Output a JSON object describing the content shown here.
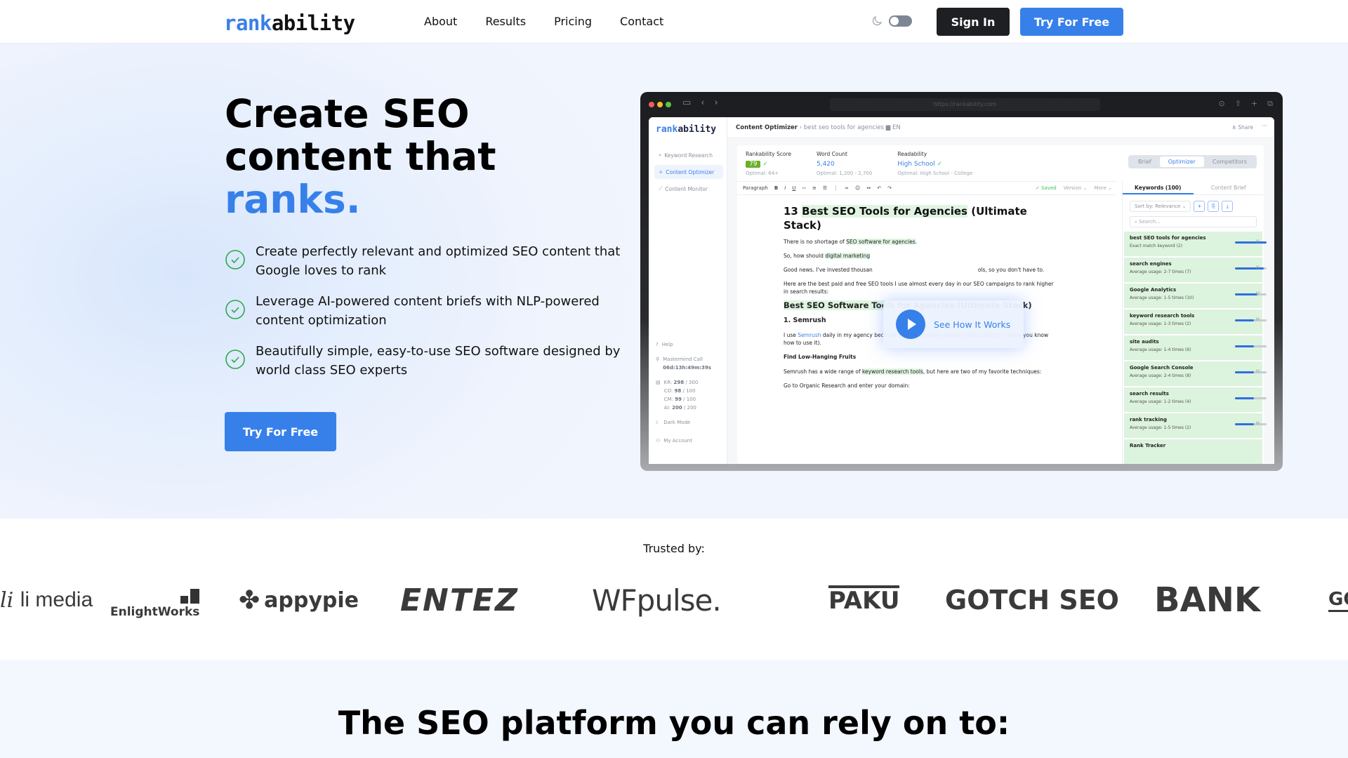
{
  "nav": {
    "logo_part1": "rank",
    "logo_part2": "ability",
    "links": [
      "About",
      "Results",
      "Pricing",
      "Contact"
    ],
    "theme_icon": "moon-icon",
    "sign_in": "Sign In",
    "try_free": "Try For Free"
  },
  "hero": {
    "title_line1": "Create SEO",
    "title_line2": "content that",
    "title_accent": "ranks.",
    "features": [
      {
        "icon": "check-circle-icon",
        "text": "Create perfectly relevant and optimized SEO content that Google loves to rank"
      },
      {
        "icon": "check-circle-icon",
        "text": "Leverage AI-powered content briefs with NLP-powered content optimization"
      },
      {
        "icon": "check-circle-icon",
        "text": "Beautifully simple, easy-to-use SEO software designed by world class SEO experts"
      }
    ],
    "cta": "Try For Free",
    "accent_color": "#3780ea"
  },
  "mockup": {
    "url": "https://rankability.com",
    "app_logo_part1": "rank",
    "app_logo_part2": "ability",
    "sidebar": [
      "Keyword Research",
      "Content Optimizer",
      "Content Monitor"
    ],
    "sidebar_active": "Content Optimizer",
    "sidebar_bottom": {
      "help": "Help",
      "mastermind": "Mastermind Call",
      "countdown": "06d:13h:49m:39s",
      "credits": [
        {
          "label": "KR:",
          "used": "298",
          "total": "/ 300"
        },
        {
          "label": "CO:",
          "used": "98",
          "total": "/ 100"
        },
        {
          "label": "CM:",
          "used": "99",
          "total": "/ 100"
        },
        {
          "label": "AI:",
          "used": "200",
          "total": "/ 200"
        }
      ],
      "dark_mode": "Dark Mode",
      "account": "My Account"
    },
    "header": {
      "title": "Content Optimizer",
      "crumb": "best seo tools for agencies",
      "lang": "EN",
      "share": "Share"
    },
    "metrics": [
      {
        "label": "Rankability Score",
        "value": "79",
        "optimal": "Optimal: 64+"
      },
      {
        "label": "Word Count",
        "value": "5,420",
        "optimal": "Optimal: 1,200 - 2,700"
      },
      {
        "label": "Readability",
        "value": "High School",
        "optimal": "Optimal: High School - College"
      }
    ],
    "segments": [
      "Brief",
      "Optimizer",
      "Competitors"
    ],
    "segment_active": "Optimizer",
    "toolbar": {
      "format": "Paragraph",
      "saved": "✓ Saved",
      "version": "Version ⌄",
      "more": "More ⌄"
    },
    "doc": {
      "h1_pre": "13 ",
      "h1_hl": "Best SEO Tools for Agencies",
      "h1_post": " (Ultimate Stack)",
      "p1_pre": "There is no shortage of ",
      "p1_hl": "SEO software for agencies",
      "p1_post": ".",
      "p2_pre": "So, how should ",
      "p2_hl": "digital marketing",
      "p3": "Good news. I've invested thousan",
      "p3_tail": "ols, so you don't have to.",
      "p4": "Here are the best paid and free SEO tools I use almost every day in our SEO campaigns to rank higher in search results:",
      "h2_hl": "Best SEO Software Tools",
      "h2_post": " for Agencies (Ultimate Stack)",
      "h3": "1. Semrush",
      "p5_pre": "I use ",
      "p5_link": "Semrush",
      "p5_post": " daily in my agency because it's a ridiculously powerful SEO platform (when you know how to use it).",
      "h4": "Find Low-Hanging Fruits",
      "p6_pre": "Semrush has a wide range of ",
      "p6_hl": "keyword research tools",
      "p6_post": ", but here are two of my favorite techniques:",
      "p7": "Go to Organic Research and enter your domain:"
    },
    "panel_tabs": [
      "Keywords (100)",
      "Content Brief"
    ],
    "sort": "Sort by: Relevance ⌄",
    "search_placeholder": "Search...",
    "keywords": [
      {
        "term": "best SEO tools for agencies",
        "usage": "Exact match keyword (2)",
        "fill": 1.0,
        "h": "H"
      },
      {
        "term": "search engines",
        "usage": "Average usage: 2-7 times (7)",
        "fill": 0.9,
        "h": "H"
      },
      {
        "term": "Google Analytics",
        "usage": "Average usage: 1-5 times (10)",
        "fill": 0.7,
        "h": "H"
      },
      {
        "term": "keyword research tools",
        "usage": "Average usage: 1-3 times (2)",
        "fill": 0.6,
        "h": "H"
      },
      {
        "term": "site audits",
        "usage": "Average usage: 1-4 times (6)",
        "fill": 0.6,
        "h": ""
      },
      {
        "term": "Google Search Console",
        "usage": "Average usage: 2-4 times (8)",
        "fill": 0.6,
        "h": "H"
      },
      {
        "term": "search results",
        "usage": "Average usage: 1-2 times (4)",
        "fill": 0.6,
        "h": ""
      },
      {
        "term": "rank tracking",
        "usage": "Average usage: 1-5 times (2)",
        "fill": 0.6,
        "h": "H"
      },
      {
        "term": "Rank Tracker",
        "usage": "",
        "fill": 0,
        "h": ""
      }
    ],
    "video_cta": "See How It Works"
  },
  "trusted": {
    "label": "Trusted by:",
    "logos": [
      "li media",
      "EnlightWorks",
      "appypie",
      "ENTEZ",
      "WFpulse.",
      "PAKU",
      "GOTCH SEO",
      "BANK",
      "GO"
    ]
  },
  "section2": {
    "title": "The SEO platform you can rely on to:"
  }
}
